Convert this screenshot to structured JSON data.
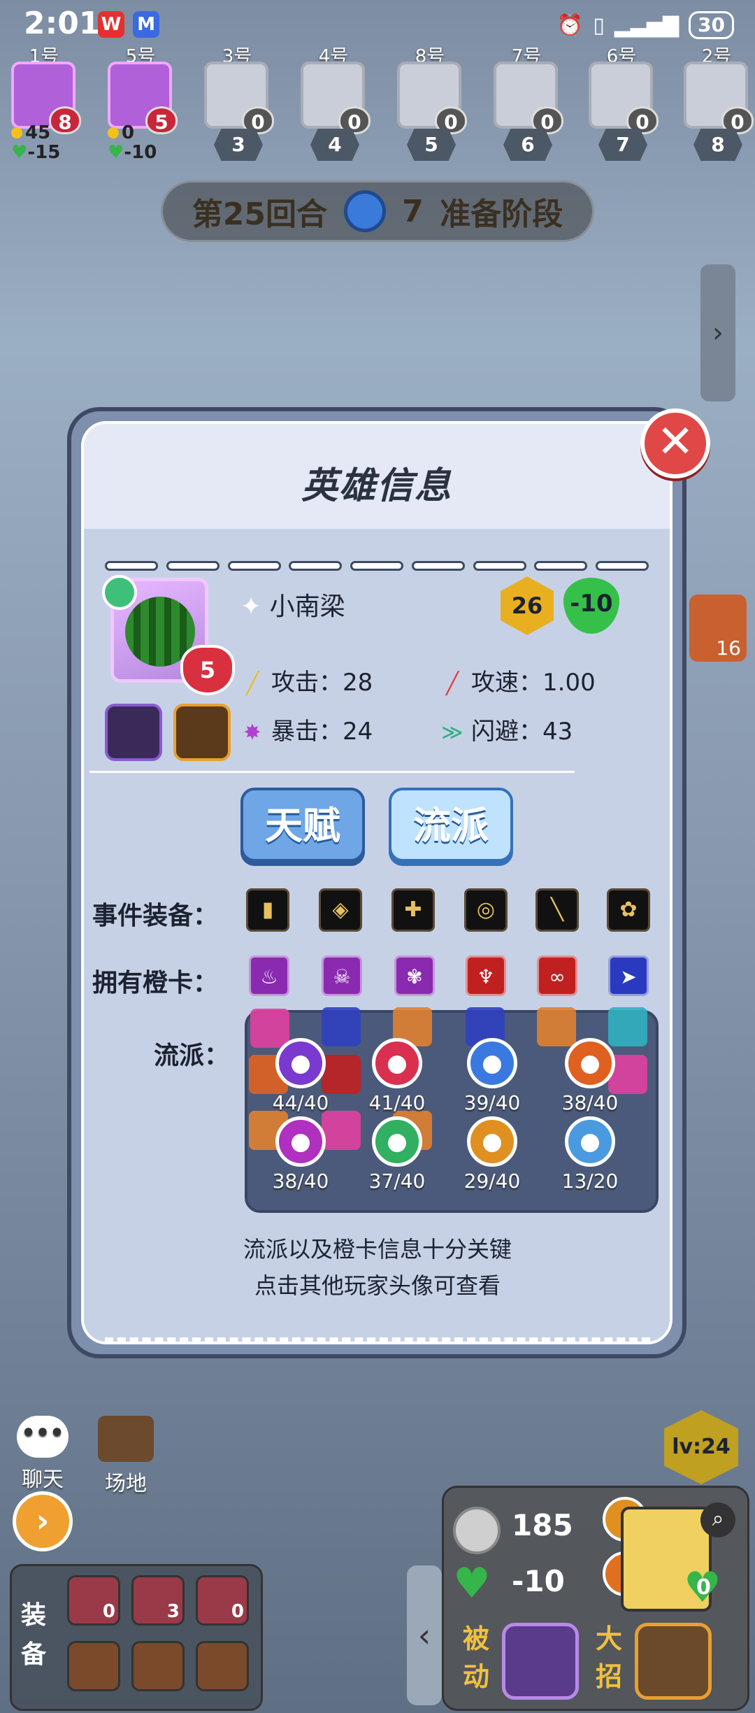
{
  "status_bar": {
    "time": "2:01",
    "battery": "30"
  },
  "players": [
    {
      "num": "1号",
      "level": "8",
      "gold": "45",
      "hp": "-15"
    },
    {
      "num": "5号",
      "level": "5",
      "gold": "0",
      "hp": "-10"
    },
    {
      "num": "3号",
      "level": "0",
      "slot": "3"
    },
    {
      "num": "4号",
      "level": "0",
      "slot": "4"
    },
    {
      "num": "8号",
      "level": "0",
      "slot": "5"
    },
    {
      "num": "7号",
      "level": "0",
      "slot": "6"
    },
    {
      "num": "6号",
      "level": "0",
      "slot": "7"
    },
    {
      "num": "2号",
      "level": "0",
      "slot": "8"
    }
  ],
  "round_banner": {
    "round": "第25回合",
    "countdown": "7",
    "phase": "准备阶段"
  },
  "modal": {
    "title": "英雄信息",
    "hero": {
      "name": "小南梁",
      "level": "5",
      "gold_level": "26",
      "hp": "-10",
      "attack_label": "攻击：",
      "attack": "28",
      "attack_speed_label": "攻速：",
      "attack_speed": "1.00",
      "crit_label": "暴击：",
      "crit": "24",
      "dodge_label": "闪避：",
      "dodge": "43"
    },
    "tabs": {
      "talent": "天赋",
      "school": "流派"
    },
    "rows": {
      "equip_label": "事件装备：",
      "cards_label": "拥有橙卡：",
      "school_label": "流派："
    },
    "schools": [
      {
        "value": "44/40",
        "color": "#7a3ad0",
        "icon": "skull-icon"
      },
      {
        "value": "41/40",
        "color": "#d93050",
        "icon": "heart-icon"
      },
      {
        "value": "39/40",
        "color": "#3a7ae0",
        "icon": "blade-icon"
      },
      {
        "value": "38/40",
        "color": "#e06020",
        "icon": "fire-icon"
      },
      {
        "value": "38/40",
        "color": "#b030c0",
        "icon": "burst-icon"
      },
      {
        "value": "37/40",
        "color": "#30b060",
        "icon": "wing-icon"
      },
      {
        "value": "29/40",
        "color": "#e09020",
        "icon": "shield-icon"
      },
      {
        "value": "13/20",
        "color": "#4a9ae0",
        "icon": "snowflake-icon"
      }
    ],
    "hint_line1": "流派以及橙卡信息十分关键",
    "hint_line2": "点击其他玩家头像可查看"
  },
  "bottom": {
    "chat": "聊天",
    "venue": "场地",
    "level": "lv:24",
    "side_count": "16",
    "equip_title": "装备",
    "equip_slots": [
      "0",
      "3",
      "0"
    ],
    "gold": "185",
    "hp": "-10",
    "shop_hp": "0",
    "passive": "被动",
    "ultimate": "大招"
  }
}
